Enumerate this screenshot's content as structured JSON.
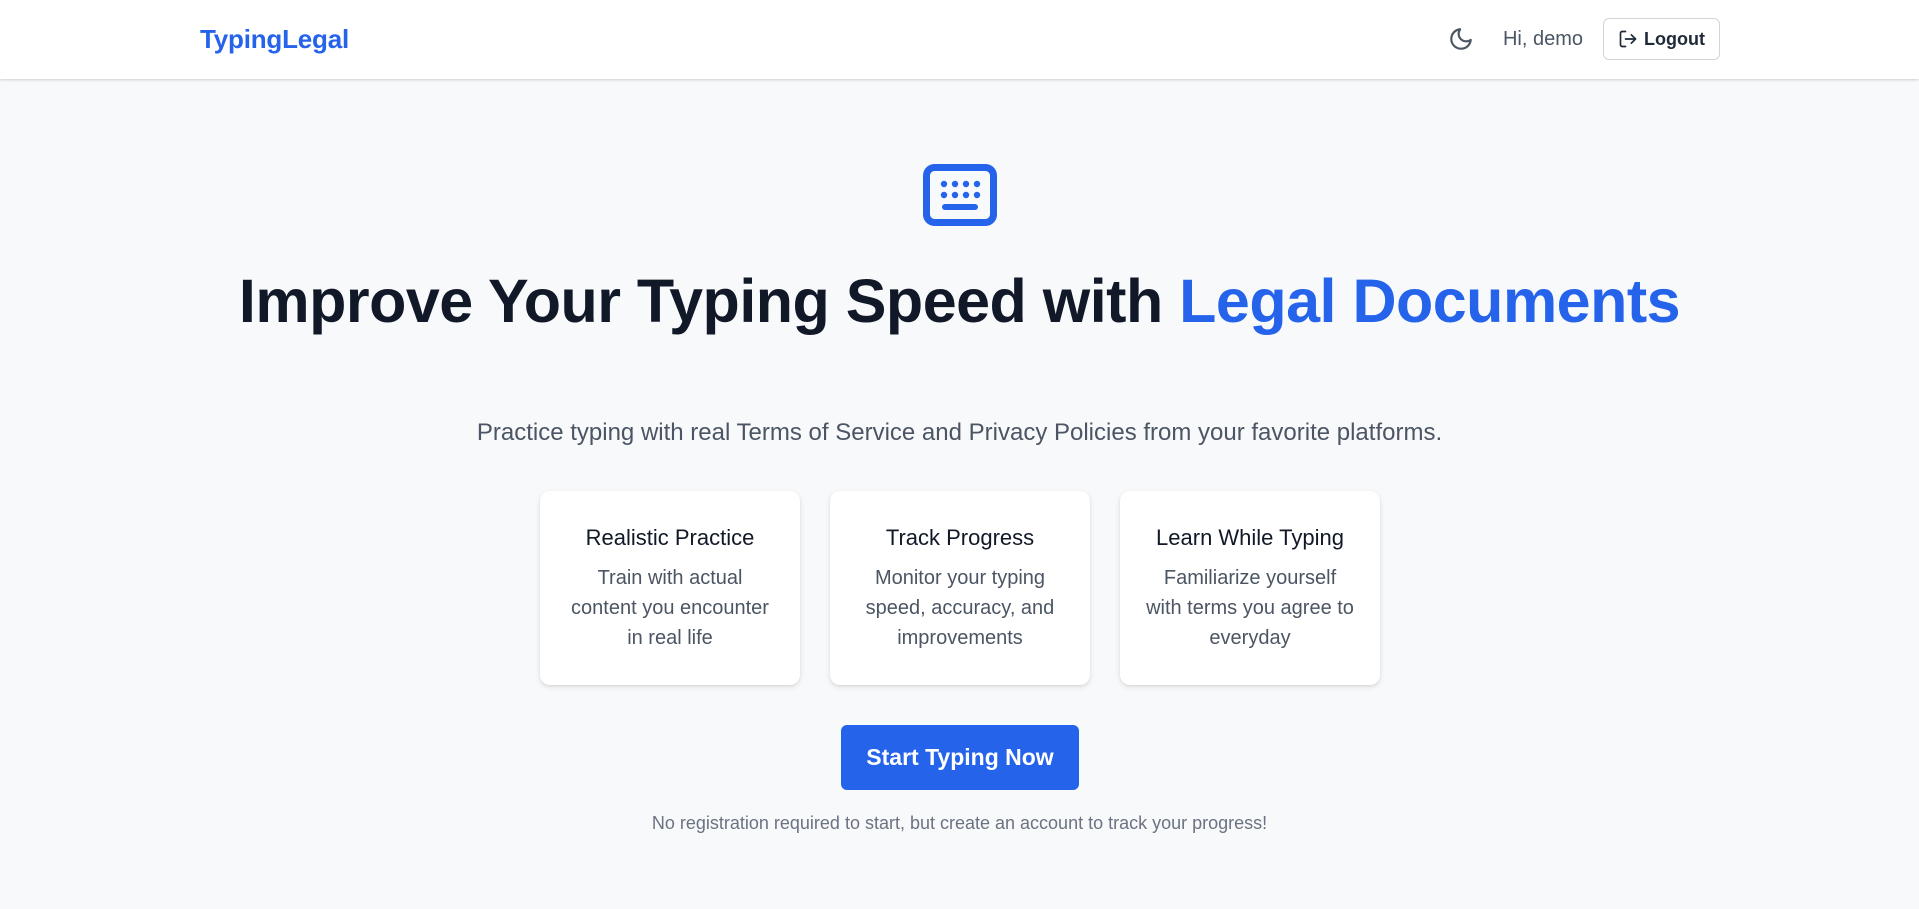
{
  "nav": {
    "brand": "TypingLegal",
    "theme_toggle_icon": "moon-icon",
    "greeting": "Hi, demo",
    "logout_label": "Logout",
    "logout_icon": "logout-icon"
  },
  "hero": {
    "icon": "keyboard-icon",
    "headline_part1": "Improve Your Typing Speed with ",
    "headline_accent": "Legal Documents",
    "subtitle": "Practice typing with real Terms of Service and Privacy Policies from your favorite platforms."
  },
  "features": [
    {
      "title": "Realistic Practice",
      "text": "Train with actual content you encounter in real life"
    },
    {
      "title": "Track Progress",
      "text": "Monitor your typing speed, accuracy, and improvements"
    },
    {
      "title": "Learn While Typing",
      "text": "Familiarize yourself with terms you agree to everyday"
    }
  ],
  "cta": {
    "label": "Start Typing Now",
    "note": "No registration required to start, but create an account to track your progress!"
  },
  "colors": {
    "accent": "#2563eb",
    "background": "#f8f9fb",
    "text": "#111827",
    "muted": "#4b5563"
  }
}
